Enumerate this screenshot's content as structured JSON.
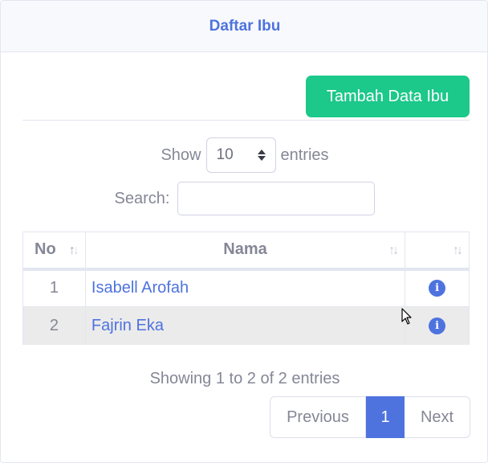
{
  "header": {
    "title": "Daftar Ibu"
  },
  "toolbar": {
    "add_label": "Tambah Data Ibu"
  },
  "length": {
    "prefix": "Show",
    "value": "10",
    "suffix": "entries"
  },
  "search": {
    "label": "Search:",
    "value": "",
    "placeholder": ""
  },
  "table": {
    "headers": {
      "no": "No",
      "nama": "Nama",
      "action": ""
    },
    "rows": [
      {
        "no": "1",
        "nama": "Isabell Arofah",
        "action_icon": "info-icon"
      },
      {
        "no": "2",
        "nama": "Fajrin Eka",
        "action_icon": "info-icon"
      }
    ],
    "sort_glyph": "↑↓"
  },
  "info": "Showing 1 to 2 of 2 entries",
  "pagination": {
    "previous": "Previous",
    "current": "1",
    "next": "Next"
  },
  "colors": {
    "primary": "#4e73df",
    "success": "#1cc88a",
    "text": "#858796"
  }
}
